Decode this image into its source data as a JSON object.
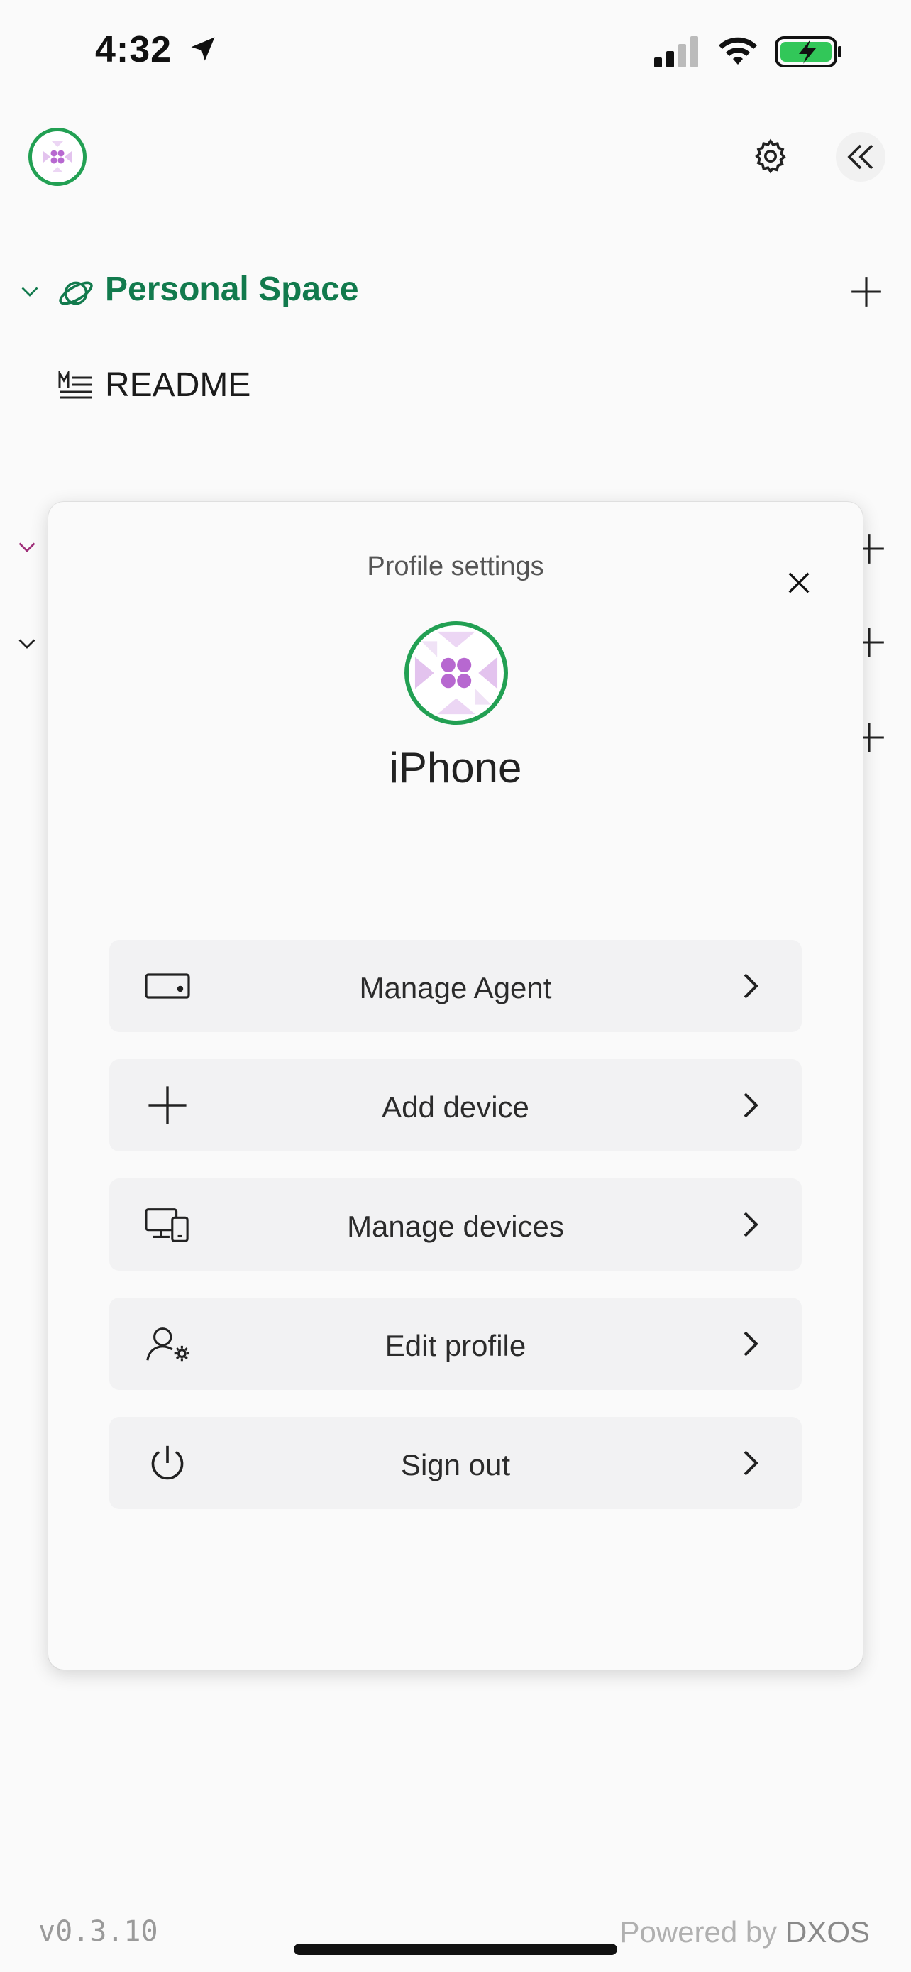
{
  "status_bar": {
    "time": "4:32"
  },
  "sidebar": {
    "space_name": "Personal Space",
    "doc_title": "README"
  },
  "dialog": {
    "title": "Profile settings",
    "device_name": "iPhone",
    "menu": [
      {
        "label": "Manage Agent",
        "icon": "drive-icon"
      },
      {
        "label": "Add device",
        "icon": "plus-icon"
      },
      {
        "label": "Manage devices",
        "icon": "devices-icon"
      },
      {
        "label": "Edit profile",
        "icon": "user-gear-icon"
      },
      {
        "label": "Sign out",
        "icon": "power-icon"
      }
    ]
  },
  "footer": {
    "version": "v0.3.10",
    "powered_prefix": "Powered by",
    "powered_brand": "DXOS"
  },
  "colors": {
    "accent_green": "#22a053",
    "space_text": "#127a4d",
    "avatar_purple": "#b768d0",
    "battery_green": "#32c759"
  }
}
